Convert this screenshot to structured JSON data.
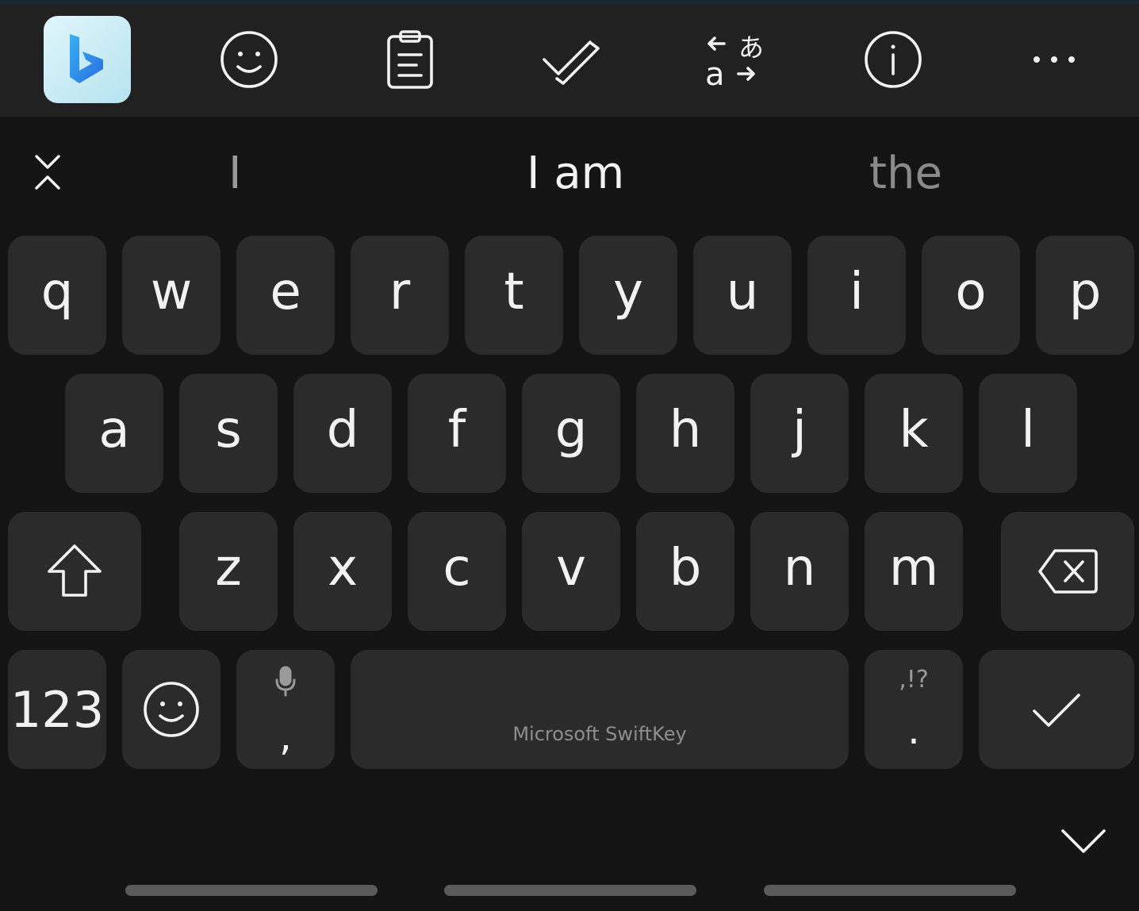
{
  "toolbar": {
    "items": [
      {
        "icon": "bing-icon"
      },
      {
        "icon": "sticker-smiley-icon"
      },
      {
        "icon": "clipboard-icon"
      },
      {
        "icon": "checkmark-edit-icon"
      },
      {
        "icon": "translate-icon"
      },
      {
        "icon": "info-icon"
      },
      {
        "icon": "more-icon"
      }
    ]
  },
  "suggestions": {
    "left": "I",
    "center": "I am",
    "right": "the"
  },
  "keys": {
    "row1": [
      "q",
      "w",
      "e",
      "r",
      "t",
      "y",
      "u",
      "i",
      "o",
      "p"
    ],
    "row2": [
      "a",
      "s",
      "d",
      "f",
      "g",
      "h",
      "j",
      "k",
      "l"
    ],
    "row3": [
      "z",
      "x",
      "c",
      "v",
      "b",
      "n",
      "m"
    ],
    "numbers": "123",
    "comma": ",",
    "period": ".",
    "punct_hint": ",!?",
    "space_label": "Microsoft SwiftKey"
  },
  "colors": {
    "background": "#141414",
    "toolbar": "#212121",
    "key": "#2b2b2b",
    "text": "#f2f2f2",
    "muted": "#8a8a8a"
  }
}
